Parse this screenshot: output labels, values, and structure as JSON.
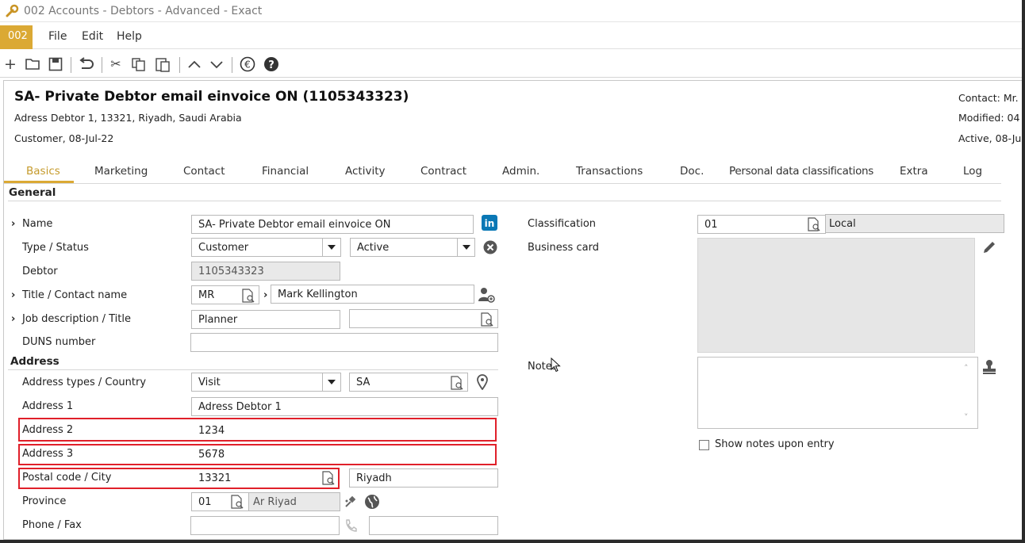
{
  "window": {
    "title": "002 Accounts - Debtors - Advanced - Exact"
  },
  "menubar": {
    "badge": "002",
    "items": [
      "File",
      "Edit",
      "Help"
    ]
  },
  "header": {
    "title": "SA- Private Debtor email einvoice ON (1105343323)",
    "address_line": "Adress Debtor 1, 13321, Riyadh, Saudi Arabia",
    "customer_line": "Customer, 08-Jul-22",
    "contact": "Contact: Mr.",
    "modified": "Modified: 04",
    "active": "Active, 08-Ju"
  },
  "tabs": [
    "Basics",
    "Marketing",
    "Contact",
    "Financial",
    "Activity",
    "Contract",
    "Admin.",
    "Transactions",
    "Doc.",
    "Personal data classifications",
    "Extra",
    "Log"
  ],
  "general": {
    "section_title": "General",
    "name_label": "Name",
    "name_value": "SA- Private Debtor email einvoice ON",
    "type_status_label": "Type / Status",
    "type_value": "Customer",
    "status_value": "Active",
    "debtor_label": "Debtor",
    "debtor_value": "1105343323",
    "title_contact_label": "Title / Contact name",
    "title_value": "MR",
    "contact_value": "Mark Kellington",
    "job_label": "Job description / Title",
    "job_value": "Planner",
    "job_title_value": "",
    "duns_label": "DUNS number",
    "duns_value": ""
  },
  "address": {
    "section_title": "Address",
    "types_country_label": "Address types / Country",
    "type_value": "Visit",
    "country_value": "SA",
    "address1_label": "Address 1",
    "address1_value": "Adress Debtor 1",
    "address2_label": "Address 2",
    "address2_value": "1234",
    "address3_label": "Address 3",
    "address3_value": "5678",
    "postal_city_label": "Postal code / City",
    "postal_value": "13321",
    "city_value": "Riyadh",
    "province_label": "Province",
    "province_code": "01",
    "province_name": "Ar Riyad",
    "phone_fax_label": "Phone / Fax",
    "phone_value": "",
    "fax_value": ""
  },
  "right": {
    "classification_label": "Classification",
    "classification_code": "01",
    "classification_name": "Local",
    "business_card_label": "Business card",
    "notes_label": "Notes",
    "show_notes_label": "Show notes upon entry",
    "show_notes_checked": false
  },
  "colors": {
    "accent": "#dba934",
    "highlight": "#e0202a",
    "linkedin": "#0a78b5"
  }
}
